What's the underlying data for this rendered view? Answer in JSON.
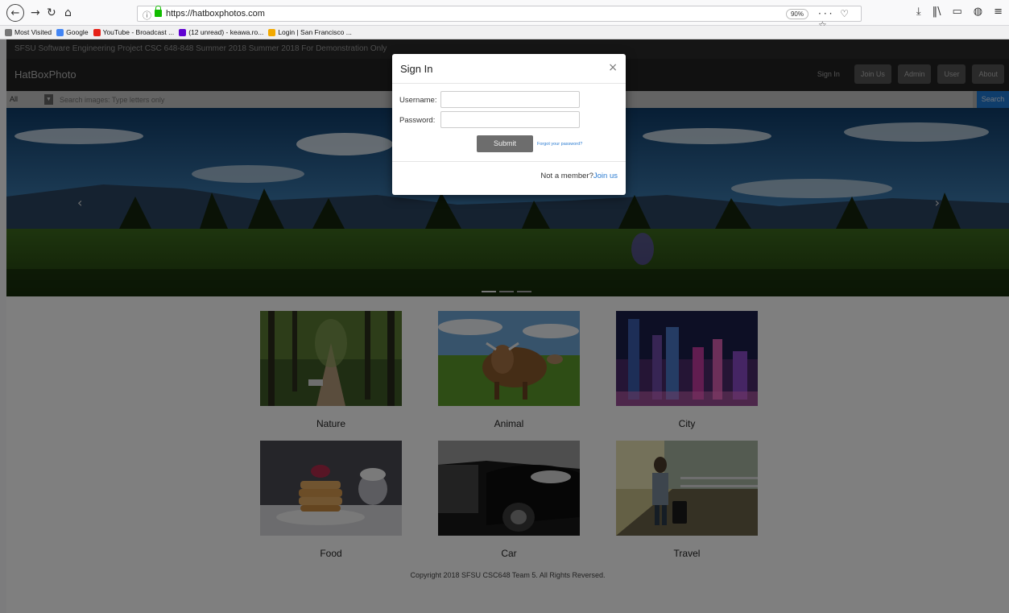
{
  "browser": {
    "url": "https://hatboxphotos.com",
    "zoom": "90%",
    "bookmarks": [
      {
        "label": "Most Visited",
        "color": "#777777"
      },
      {
        "label": "Google",
        "color": "#4285f4"
      },
      {
        "label": "YouTube - Broadcast ...",
        "color": "#e62117"
      },
      {
        "label": "(12 unread) - keawa.ro...",
        "color": "#5f01d1"
      },
      {
        "label": "Login | San Francisco ...",
        "color": "#f2a900"
      }
    ]
  },
  "site": {
    "notice": "SFSU Software Engineering Project CSC 648-848 Summer 2018 Summer 2018 For Demonstration Only",
    "brand": "HatBoxPhoto",
    "nav": {
      "signin": "Sign In",
      "join": "Join Us",
      "admin": "Admin",
      "user": "User",
      "about": "About"
    },
    "search": {
      "category": "All",
      "placeholder": "Search images: Type letters only",
      "button": "Search"
    },
    "categories": [
      {
        "label": "Nature"
      },
      {
        "label": "Animal"
      },
      {
        "label": "City"
      },
      {
        "label": "Food"
      },
      {
        "label": "Car"
      },
      {
        "label": "Travel"
      }
    ],
    "footer": "Copyright 2018 SFSU CSC648 Team 5. All Rights Reversed."
  },
  "modal": {
    "title": "Sign In",
    "close": "×",
    "username_label": "Username:",
    "password_label": "Password:",
    "submit": "Submit",
    "forgot": "Forgot your password?",
    "not_member": "Not a member?",
    "join": "Join us"
  }
}
